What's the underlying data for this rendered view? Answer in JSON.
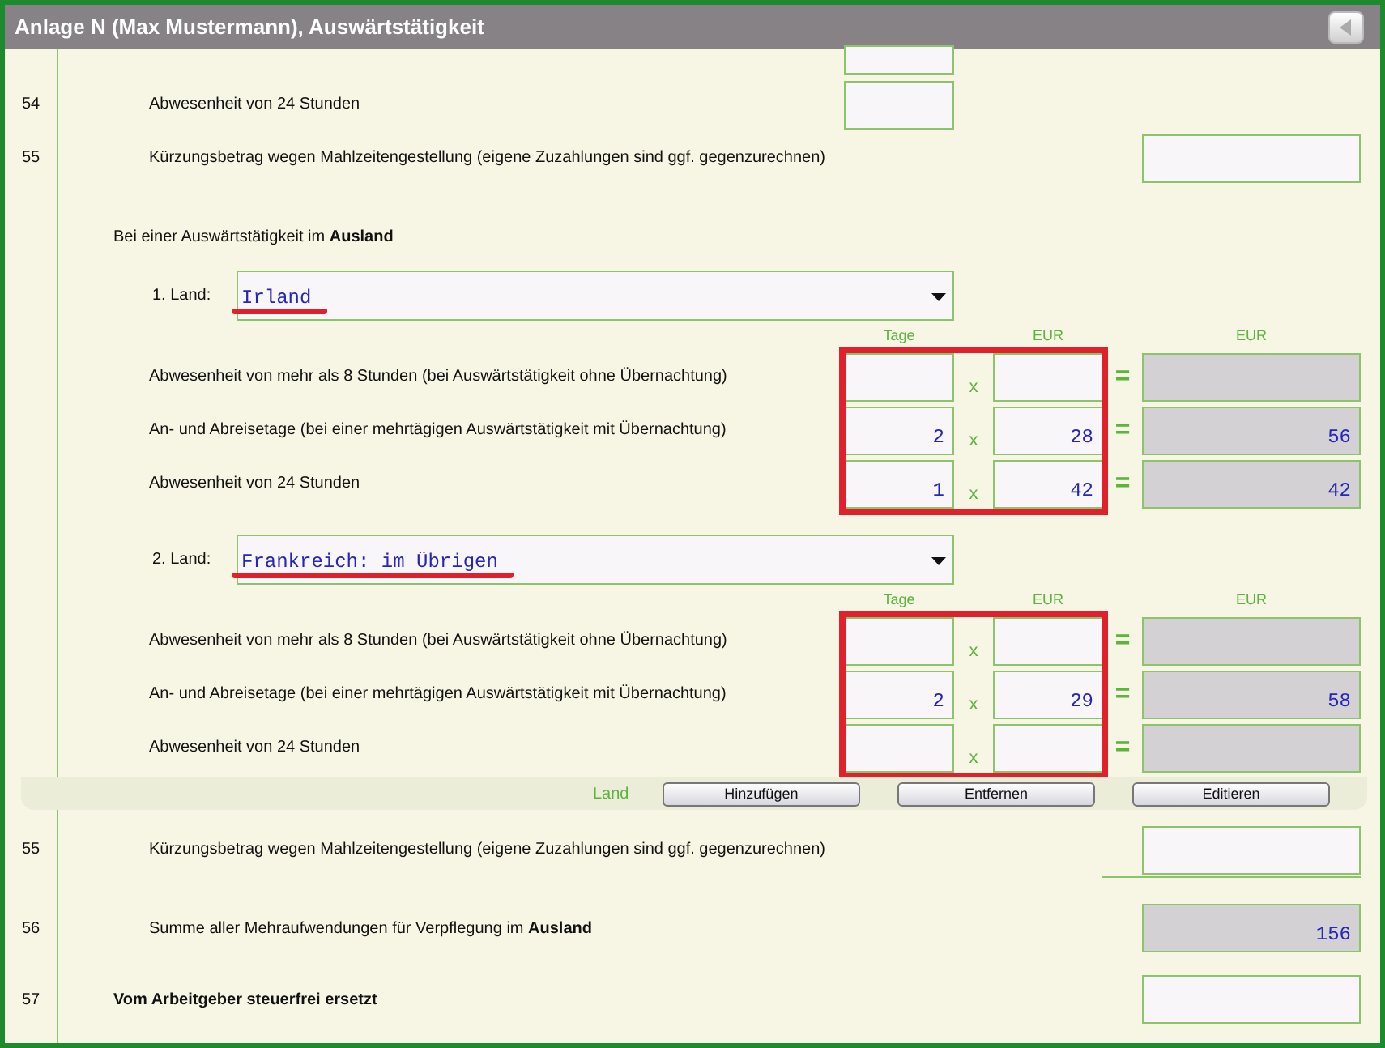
{
  "window": {
    "title": "Anlage N (Max Mustermann), Auswärtstätigkeit"
  },
  "domestic_lines": [
    {
      "kind": "partial"
    },
    {
      "number": "54",
      "label": "Abwesenheit von 24 Stunden",
      "kind": "small"
    },
    {
      "number": "55",
      "label": "Kürzungsbetrag wegen Mahlzeitengestellung (eigene Zuzahlungen sind ggf. gegenzurechnen)",
      "kind": "wide"
    }
  ],
  "abroad": {
    "intro": "Bei einer Auswärtstätigkeit im **Ausland**",
    "countries": [
      {
        "label": "1. Land:",
        "value": "Irland",
        "headings": [
          "Tage",
          "EUR",
          "EUR"
        ],
        "rows": [
          {
            "label": "Abwesenheit von mehr als 8 Stunden (bei Auswärtstätigkeit ohne Übernachtung)",
            "multiply": "x",
            "equals": "="
          },
          {
            "label": "An- und Abreisetage (bei einer mehrtägigen Auswärtstätigkeit mit Übernachtung)",
            "days": "2",
            "multiply": "x",
            "rate": "28",
            "equals": "=",
            "total": "56"
          },
          {
            "label": "Abwesenheit von 24 Stunden",
            "days": "1",
            "multiply": "x",
            "rate": "42",
            "equals": "=",
            "total": "42"
          }
        ]
      },
      {
        "label": "2. Land:",
        "value": "Frankreich: im Übrigen",
        "headings": [
          "Tage",
          "EUR",
          "EUR"
        ],
        "rows": [
          {
            "label": "Abwesenheit von mehr als 8 Stunden (bei Auswärtstätigkeit ohne Übernachtung)",
            "multiply": "x",
            "equals": "="
          },
          {
            "label": "An- und Abreisetage (bei einer mehrtägigen Auswärtstätigkeit mit Übernachtung)",
            "days": "2",
            "multiply": "x",
            "rate": "29",
            "equals": "=",
            "total": "58"
          },
          {
            "label": "Abwesenheit von 24 Stunden",
            "multiply": "x",
            "equals": "="
          }
        ]
      }
    ]
  },
  "country_actions": {
    "label": "Land",
    "buttons": [
      "Hinzufügen",
      "Entfernen",
      "Editieren"
    ]
  },
  "summary_lines": [
    {
      "number": "55",
      "label": "Kürzungsbetrag wegen Mahlzeitengestellung (eigene Zuzahlungen sind ggf. gegenzurechnen)",
      "kind": "item",
      "readonly": false
    },
    {
      "number": "56",
      "label": "Summe aller Mehraufwendungen für Verpflegung im **Ausland**",
      "kind": "item",
      "readonly": true,
      "value": "156"
    },
    {
      "number": "57",
      "label": "Vom Arbeitgeber steuerfrei ersetzt",
      "kind": "heading",
      "readonly": false
    }
  ]
}
